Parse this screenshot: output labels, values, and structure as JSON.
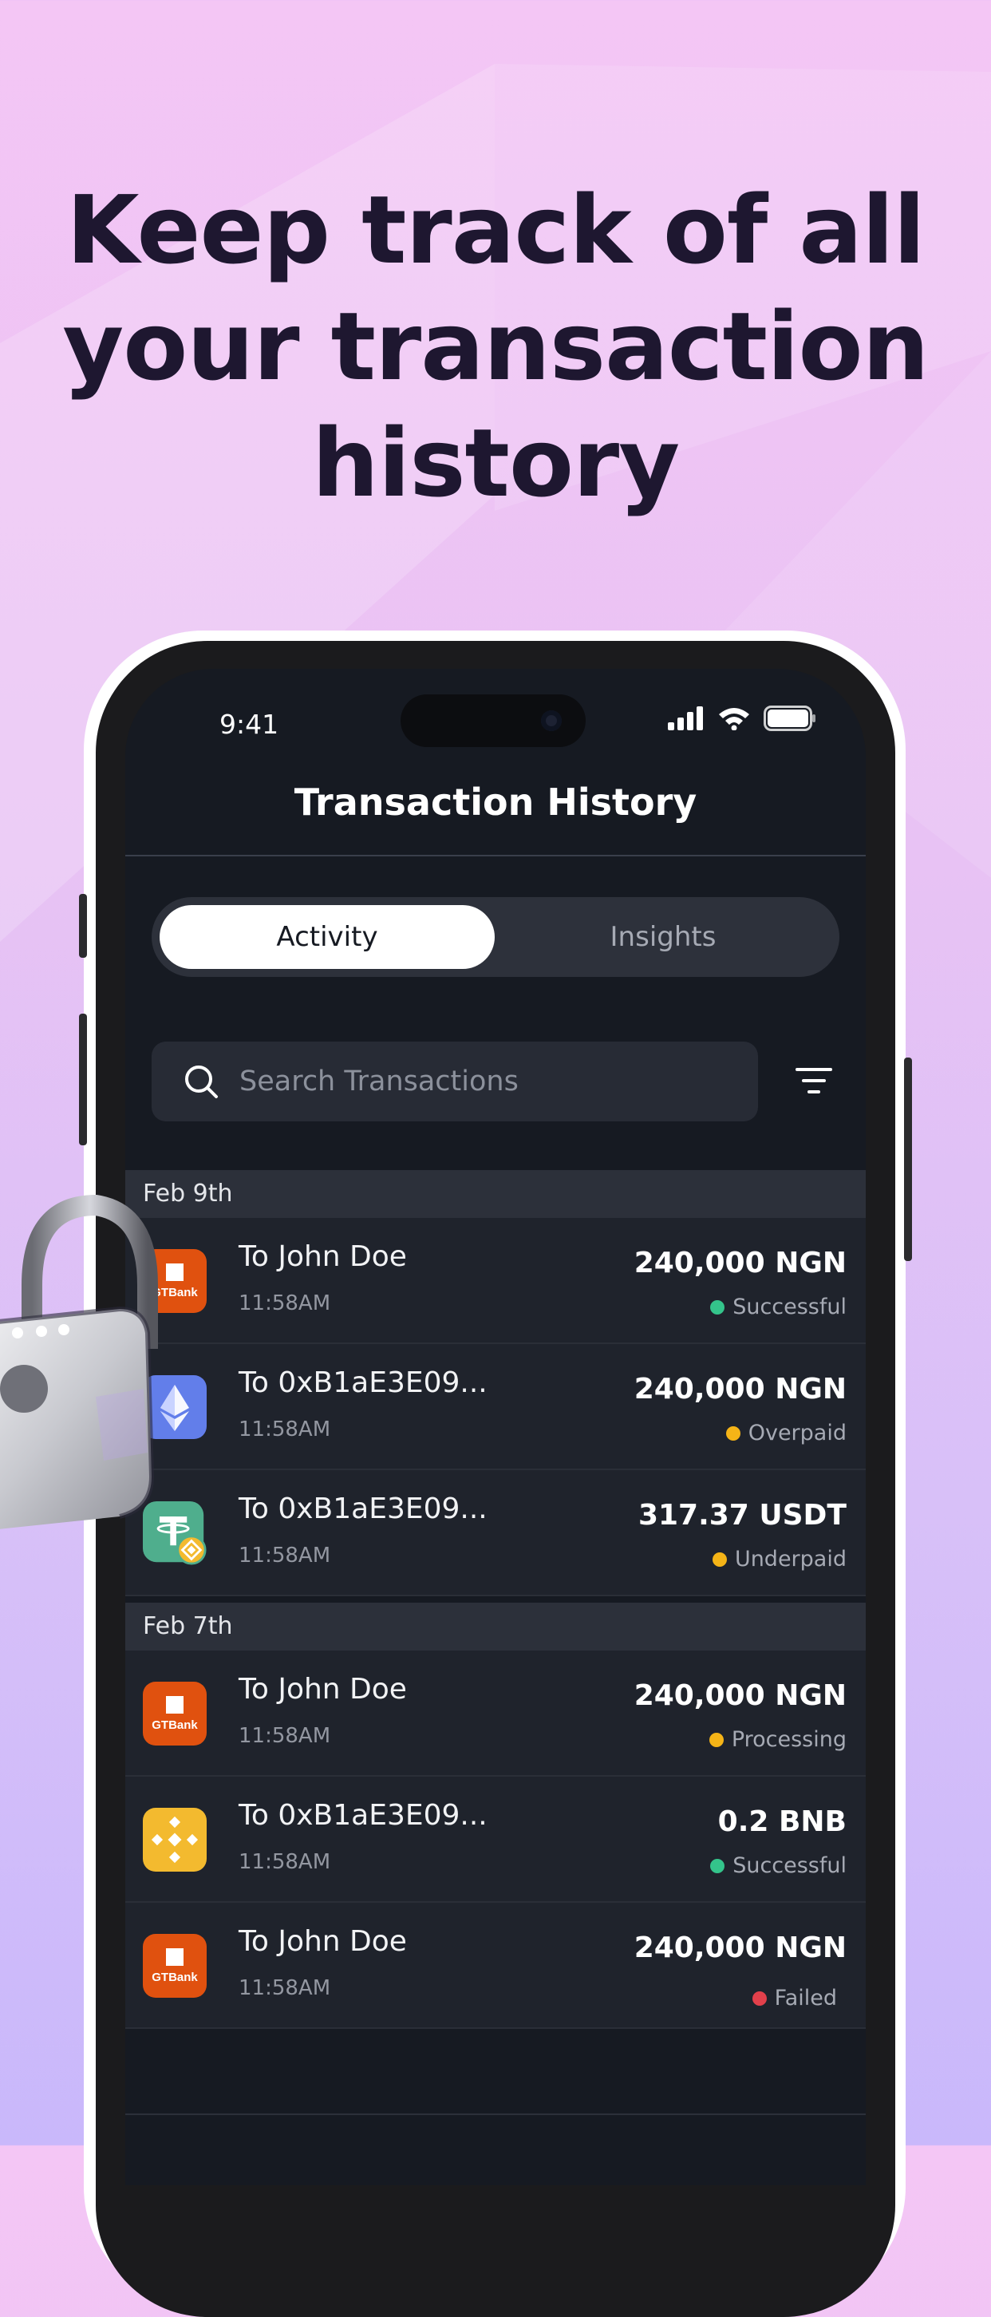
{
  "headline": [
    "Keep track of all",
    "your transaction",
    "history"
  ],
  "status_bar": {
    "time": "9:41"
  },
  "nav": {
    "title": "Transaction History"
  },
  "tabs": {
    "active": "Activity",
    "inactive": "Insights"
  },
  "search": {
    "placeholder": "Search Transactions"
  },
  "groups": [
    {
      "date": "Feb 9th",
      "transactions": [
        {
          "icon": "gtbank-icon",
          "icon_text": "GTBank",
          "name": "To John Doe",
          "time": "11:58AM",
          "amount": "240,000 NGN",
          "status": "Successful",
          "status_color": "#34c48b"
        },
        {
          "icon": "ethereum-icon",
          "name": "To 0xB1aE3E09...",
          "time": "11:58AM",
          "amount": "240,000 NGN",
          "status": "Overpaid",
          "status_color": "#f5b417"
        },
        {
          "icon": "tether-bnb-icon",
          "name": "To 0xB1aE3E09...",
          "time": "11:58AM",
          "amount": "317.37 USDT",
          "status": "Underpaid",
          "status_color": "#f5b417"
        }
      ]
    },
    {
      "date": "Feb 7th",
      "transactions": [
        {
          "icon": "gtbank-icon",
          "icon_text": "GTBank",
          "name": "To John Doe",
          "time": "11:58AM",
          "amount": "240,000 NGN",
          "status": "Processing",
          "status_color": "#f5b417"
        },
        {
          "icon": "binance-icon",
          "name": "To 0xB1aE3E09...",
          "time": "11:58AM",
          "amount": "0.2 BNB",
          "status": "Successful",
          "status_color": "#34c48b"
        },
        {
          "icon": "gtbank-icon",
          "icon_text": "GTBank",
          "name": "To John Doe",
          "time": "11:58AM",
          "amount": "240,000 NGN",
          "status": "Failed",
          "status_color": "#e2404b"
        }
      ]
    }
  ]
}
